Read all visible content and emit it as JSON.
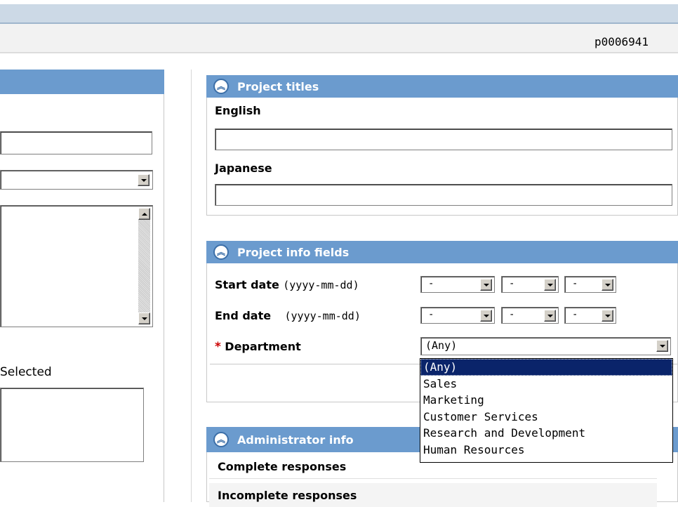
{
  "header": {
    "user_id": "p0006941"
  },
  "left_panel": {
    "selected_label": "Selected"
  },
  "project_titles": {
    "title": "Project titles",
    "english_label": "English",
    "english_value": "",
    "japanese_label": "Japanese",
    "japanese_value": ""
  },
  "project_info": {
    "title": "Project info fields",
    "start_date_label": "Start date",
    "start_date_format": "(yyyy-mm-dd)",
    "end_date_label": "End date",
    "end_date_format": "(yyyy-mm-dd)",
    "date_placeholder": "-",
    "required_marker": "*",
    "department_label": "Department",
    "department_value": "(Any)",
    "department_options": [
      "(Any)",
      "Sales",
      "Marketing",
      "Customer Services",
      "Research and Development",
      "Human Resources"
    ]
  },
  "admin_info": {
    "title": "Administrator info",
    "rows": [
      "Complete responses",
      "Incomplete responses"
    ]
  },
  "colors": {
    "panel_header": "#6b9bce",
    "required": "#cc0000",
    "selected_option": "#0a246a"
  },
  "icons": {
    "collapse": "double-chevron-up-icon",
    "dropdown": "chevron-down-icon"
  }
}
